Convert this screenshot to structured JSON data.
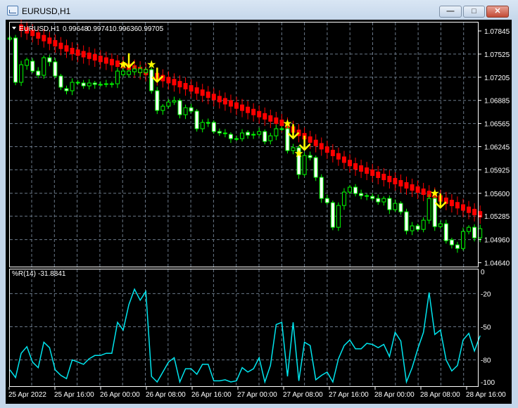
{
  "window": {
    "title": "EURUSD,H1",
    "minimize_label": "—",
    "maximize_label": "□",
    "close_label": "✕"
  },
  "chart_header": {
    "symbol": "EURUSD,H1",
    "open": "0.99648",
    "high": "0.99741",
    "low": "0.99636",
    "close": "0.99705"
  },
  "indicator_header": {
    "name": "%R(14)",
    "value": "-31.8841"
  },
  "colors": {
    "bull_outline": "#00ff00",
    "bear_fill": "#ffffff",
    "trend": "#ff0000",
    "signal": "#ffff00",
    "wpr_line": "#00e5ee",
    "grid": "#6a7888",
    "axis_text": "#ffffff"
  },
  "chart_data": [
    {
      "type": "candlestick",
      "title": "EURUSD,H1",
      "price_ticks": [
        "1.07845",
        "1.07525",
        "1.07205",
        "1.06885",
        "1.06565",
        "1.06245",
        "1.05925",
        "1.05600",
        "1.05285",
        "1.04960",
        "1.04640"
      ],
      "ylim": [
        1.0464,
        1.07845
      ],
      "x_labels": [
        "25 Apr 2022",
        "25 Apr 16:00",
        "26 Apr 00:00",
        "26 Apr 08:00",
        "26 Apr 16:00",
        "27 Apr 00:00",
        "27 Apr 08:00",
        "27 Apr 16:00",
        "28 Apr 00:00",
        "28 Apr 08:00",
        "28 Apr 16:00"
      ],
      "candles_open_close": [
        [
          1.0773,
          1.07748
        ],
        [
          1.07748,
          1.07135
        ],
        [
          1.07135,
          1.07378
        ],
        [
          1.07368,
          1.07446
        ],
        [
          1.07427,
          1.0729
        ],
        [
          1.0729,
          1.07232
        ],
        [
          1.07232,
          1.07475
        ],
        [
          1.07475,
          1.07417
        ],
        [
          1.07417,
          1.07222
        ],
        [
          1.07222,
          1.07067
        ],
        [
          1.07047,
          1.07018
        ],
        [
          1.07018,
          1.07135
        ],
        [
          1.07125,
          1.07135
        ],
        [
          1.07125,
          1.07086
        ],
        [
          1.07086,
          1.07125
        ],
        [
          1.07125,
          1.07106
        ],
        [
          1.07106,
          1.07102
        ],
        [
          1.07106,
          1.07115
        ],
        [
          1.07115,
          1.07112
        ],
        [
          1.07115,
          1.0729
        ],
        [
          1.07242,
          1.0729
        ],
        [
          1.07242,
          1.0729
        ],
        [
          1.07281,
          1.0732
        ],
        [
          1.07271,
          1.0732
        ],
        [
          1.07271,
          1.0731
        ],
        [
          1.0731,
          1.07018
        ],
        [
          1.07018,
          1.06746
        ],
        [
          1.06746,
          1.06804
        ],
        [
          1.06804,
          1.06862
        ],
        [
          1.06862,
          1.06882
        ],
        [
          1.06882,
          1.06687
        ],
        [
          1.06687,
          1.06784
        ],
        [
          1.06784,
          1.06736
        ],
        [
          1.06736,
          1.06493
        ],
        [
          1.06493,
          1.0658
        ],
        [
          1.0658,
          1.06577
        ],
        [
          1.0658,
          1.06454
        ],
        [
          1.06454,
          1.06434
        ],
        [
          1.06425,
          1.06434
        ],
        [
          1.06415,
          1.06356
        ],
        [
          1.06356,
          1.06353
        ],
        [
          1.06356,
          1.06434
        ],
        [
          1.06444,
          1.06405
        ],
        [
          1.06415,
          1.06412
        ],
        [
          1.06415,
          1.06454
        ],
        [
          1.06454,
          1.06317
        ],
        [
          1.06327,
          1.06395
        ],
        [
          1.06395,
          1.06493
        ],
        [
          1.06493,
          1.0649
        ],
        [
          1.06493,
          1.06191
        ],
        [
          1.06191,
          1.0623
        ],
        [
          1.0623,
          1.0586
        ],
        [
          1.0586,
          1.06123
        ],
        [
          1.06123,
          1.06094
        ],
        [
          1.06094,
          1.05821
        ],
        [
          1.05821,
          1.05529
        ],
        [
          1.05529,
          1.05471
        ],
        [
          1.05471,
          1.0513
        ],
        [
          1.0513,
          1.05432
        ],
        [
          1.05432,
          1.05617
        ],
        [
          1.05617,
          1.05685
        ],
        [
          1.05685,
          1.05597
        ],
        [
          1.05597,
          1.05568
        ],
        [
          1.05568,
          1.05565
        ],
        [
          1.05558,
          1.05529
        ],
        [
          1.05529,
          1.05481
        ],
        [
          1.05481,
          1.05529
        ],
        [
          1.05529,
          1.05374
        ],
        [
          1.05374,
          1.05461
        ],
        [
          1.05461,
          1.05344
        ],
        [
          1.05344,
          1.05082
        ],
        [
          1.05082,
          1.0515
        ],
        [
          1.0515,
          1.05101
        ],
        [
          1.05101,
          1.05228
        ],
        [
          1.05228,
          1.05529
        ],
        [
          1.05529,
          1.0514
        ],
        [
          1.0514,
          1.05179
        ],
        [
          1.05179,
          1.04945
        ],
        [
          1.04955,
          1.04887
        ],
        [
          1.04887,
          1.04838
        ],
        [
          1.04838,
          1.05072
        ],
        [
          1.05072,
          1.0513
        ],
        [
          1.0513,
          1.04984
        ],
        [
          1.04984,
          1.05111
        ]
      ],
      "trend_anchors": [
        [
          2,
          1.07933
        ],
        [
          11,
          1.07611
        ],
        [
          23,
          1.07349
        ],
        [
          31,
          1.07125
        ],
        [
          48,
          1.06619
        ],
        [
          61,
          1.06016
        ],
        [
          73,
          1.05666
        ],
        [
          83,
          1.05354
        ]
      ],
      "star_signals": [
        [
          20,
          1.0738
        ],
        [
          25,
          1.0738
        ],
        [
          49,
          1.06565
        ],
        [
          51,
          1.0615
        ],
        [
          75,
          1.056
        ]
      ],
      "arrow_signals": [
        [
          21,
          1.0742
        ],
        [
          26,
          1.0722
        ],
        [
          50,
          1.0644
        ],
        [
          52,
          1.0628
        ],
        [
          76,
          1.0548
        ]
      ]
    },
    {
      "type": "line",
      "title": "%R(14)",
      "y_ticks": [
        "0",
        "-20",
        "-50",
        "-80",
        "-100"
      ],
      "ylim": [
        -100,
        0
      ],
      "values": [
        -89,
        -96,
        -74,
        -68,
        -82,
        -87,
        -64,
        -69,
        -89,
        -94,
        -97,
        -80,
        -82,
        -84,
        -79,
        -76,
        -76,
        -74,
        -74,
        -46,
        -53,
        -30,
        -16,
        -26,
        -18,
        -95,
        -100,
        -91,
        -82,
        -78,
        -100,
        -88,
        -88,
        -93,
        -84,
        -84,
        -99,
        -99,
        -98,
        -100,
        -99,
        -87,
        -91,
        -88,
        -78,
        -100,
        -85,
        -48,
        -46,
        -95,
        -46,
        -99,
        -64,
        -67,
        -98,
        -94,
        -91,
        -100,
        -79,
        -67,
        -62,
        -70,
        -70,
        -65,
        -66,
        -69,
        -66,
        -77,
        -55,
        -63,
        -100,
        -87,
        -70,
        -55,
        -19,
        -57,
        -53,
        -80,
        -90,
        -85,
        -62,
        -56,
        -72,
        -58
      ]
    }
  ]
}
